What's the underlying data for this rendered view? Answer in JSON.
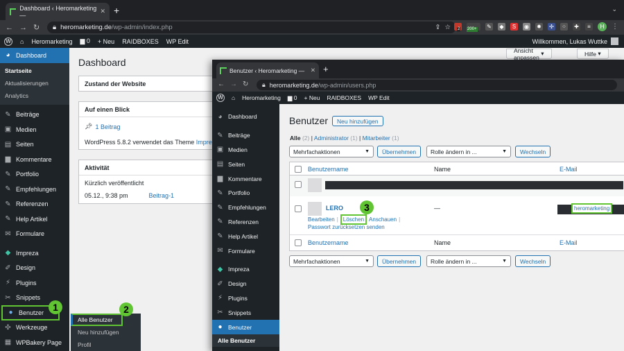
{
  "back": {
    "tab_title": "Dashboard ‹ Heromarketing —",
    "url_domain": "heromarketing.de",
    "url_path": "/wp-admin/index.php",
    "ext_badges": {
      "a": "2",
      "b": "200+"
    },
    "profile_initial": "H",
    "adminbar": {
      "site": "Heromarketing",
      "comments": "0",
      "new": "Neu",
      "raidboxes": "RAIDBOXES",
      "wpedit": "WP Edit",
      "welcome": "Willkommen, Lukas Wuttke"
    },
    "screen_options": "Ansicht anpassen",
    "help": "Hilfe",
    "sidebar": {
      "dashboard": "Dashboard",
      "submenu": [
        "Startseite",
        "Aktualisierungen",
        "Analytics"
      ],
      "items": [
        "Beiträge",
        "Medien",
        "Seiten",
        "Kommentare",
        "Portfolio",
        "Empfehlungen",
        "Referenzen",
        "Help Artikel",
        "Formulare",
        "Impreza",
        "Design",
        "Plugins",
        "Snippets",
        "Benutzer",
        "Werkzeuge",
        "WPBakery Page"
      ]
    },
    "flyout": [
      "Alle Benutzer",
      "Neu hinzufügen",
      "Profil"
    ],
    "page_title": "Dashboard",
    "site_health": "Zustand der Website",
    "glance_title": "Auf einen Blick",
    "glance_posts": "1 Beitrag",
    "glance_text": "WordPress 5.8.2 verwendet das Theme",
    "glance_theme": "Impreza",
    "activity_title": "Aktivität",
    "activity_sub": "Kürzlich veröffentlicht",
    "activity_date": "05.12., 9:38 pm",
    "activity_post": "Beitrag-1"
  },
  "front": {
    "tab_title": "Benutzer ‹ Heromarketing — W",
    "url_domain": "heromarketing.de",
    "url_path": "/wp-admin/users.php",
    "adminbar": {
      "site": "Heromarketing",
      "comments": "0",
      "new": "Neu",
      "raidboxes": "RAIDBOXES",
      "wpedit": "WP Edit"
    },
    "sidebar": {
      "items": [
        "Dashboard",
        "Beiträge",
        "Medien",
        "Seiten",
        "Kommentare",
        "Portfolio",
        "Empfehlungen",
        "Referenzen",
        "Help Artikel",
        "Formulare",
        "Impreza",
        "Design",
        "Plugins",
        "Snippets",
        "Benutzer"
      ],
      "sub": "Alle Benutzer"
    },
    "page_title": "Benutzer",
    "add_new": "Neu hinzufügen",
    "filters": {
      "all": "Alle",
      "all_count": "(2)",
      "admin": "Administrator",
      "admin_count": "(1)",
      "staff": "Mitarbeiter",
      "staff_count": "(1)"
    },
    "bulk": "Mehrfachaktionen",
    "apply": "Übernehmen",
    "role": "Rolle ändern in ...",
    "change": "Wechseln",
    "columns": {
      "username": "Benutzername",
      "name": "Name",
      "email": "E-Mail"
    },
    "user": {
      "login": "LERO",
      "name": "—",
      "edit": "Bearbeiten",
      "delete": "Löschen",
      "view": "Anschauen",
      "reset": "Passwort zurücksetzen senden",
      "email": "heromarketing"
    }
  },
  "steps": [
    "1",
    "2",
    "3"
  ],
  "colors": {
    "wp_blue": "#2271b1",
    "highlight": "#61c533",
    "admin_dark": "#1d2327"
  }
}
